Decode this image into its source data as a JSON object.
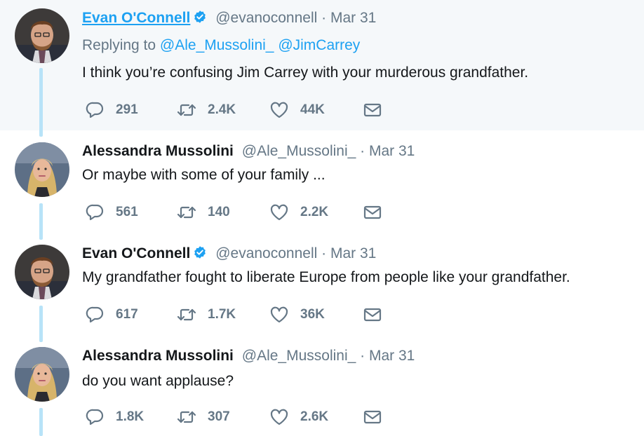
{
  "tweets": [
    {
      "name": "Evan O'Connell",
      "handle": "@evanoconnell",
      "separator": "·",
      "date": "Mar 31",
      "verified": true,
      "replying_label": "Replying to",
      "replying_to": [
        "@Ale_Mussolini_",
        "@JimCarrey"
      ],
      "text": "I think you’re confusing Jim Carrey with your murderous grandfather.",
      "replies": "291",
      "retweets": "2.4K",
      "likes": "44K"
    },
    {
      "name": "Alessandra Mussolini",
      "handle": "@Ale_Mussolini_",
      "separator": "·",
      "date": "Mar 31",
      "verified": false,
      "text": "Or maybe with some of your family ...",
      "replies": "561",
      "retweets": "140",
      "likes": "2.2K"
    },
    {
      "name": "Evan O'Connell",
      "handle": "@evanoconnell",
      "separator": "·",
      "date": "Mar 31",
      "verified": true,
      "text": "My grandfather fought to liberate Europe from people like your grandfather.",
      "replies": "617",
      "retweets": "1.7K",
      "likes": "36K"
    },
    {
      "name": "Alessandra Mussolini",
      "handle": "@Ale_Mussolini_",
      "separator": "·",
      "date": "Mar 31",
      "verified": false,
      "text": "do you want applause?",
      "replies": "1.8K",
      "retweets": "307",
      "likes": "2.6K"
    }
  ],
  "colors": {
    "accent": "#1da1f2",
    "muted": "#657786",
    "thread": "#b8e3f8",
    "highlight_bg": "#f5f8fa"
  },
  "icons": [
    "reply-icon",
    "retweet-icon",
    "like-icon",
    "direct-message-icon",
    "verified-badge-icon"
  ]
}
